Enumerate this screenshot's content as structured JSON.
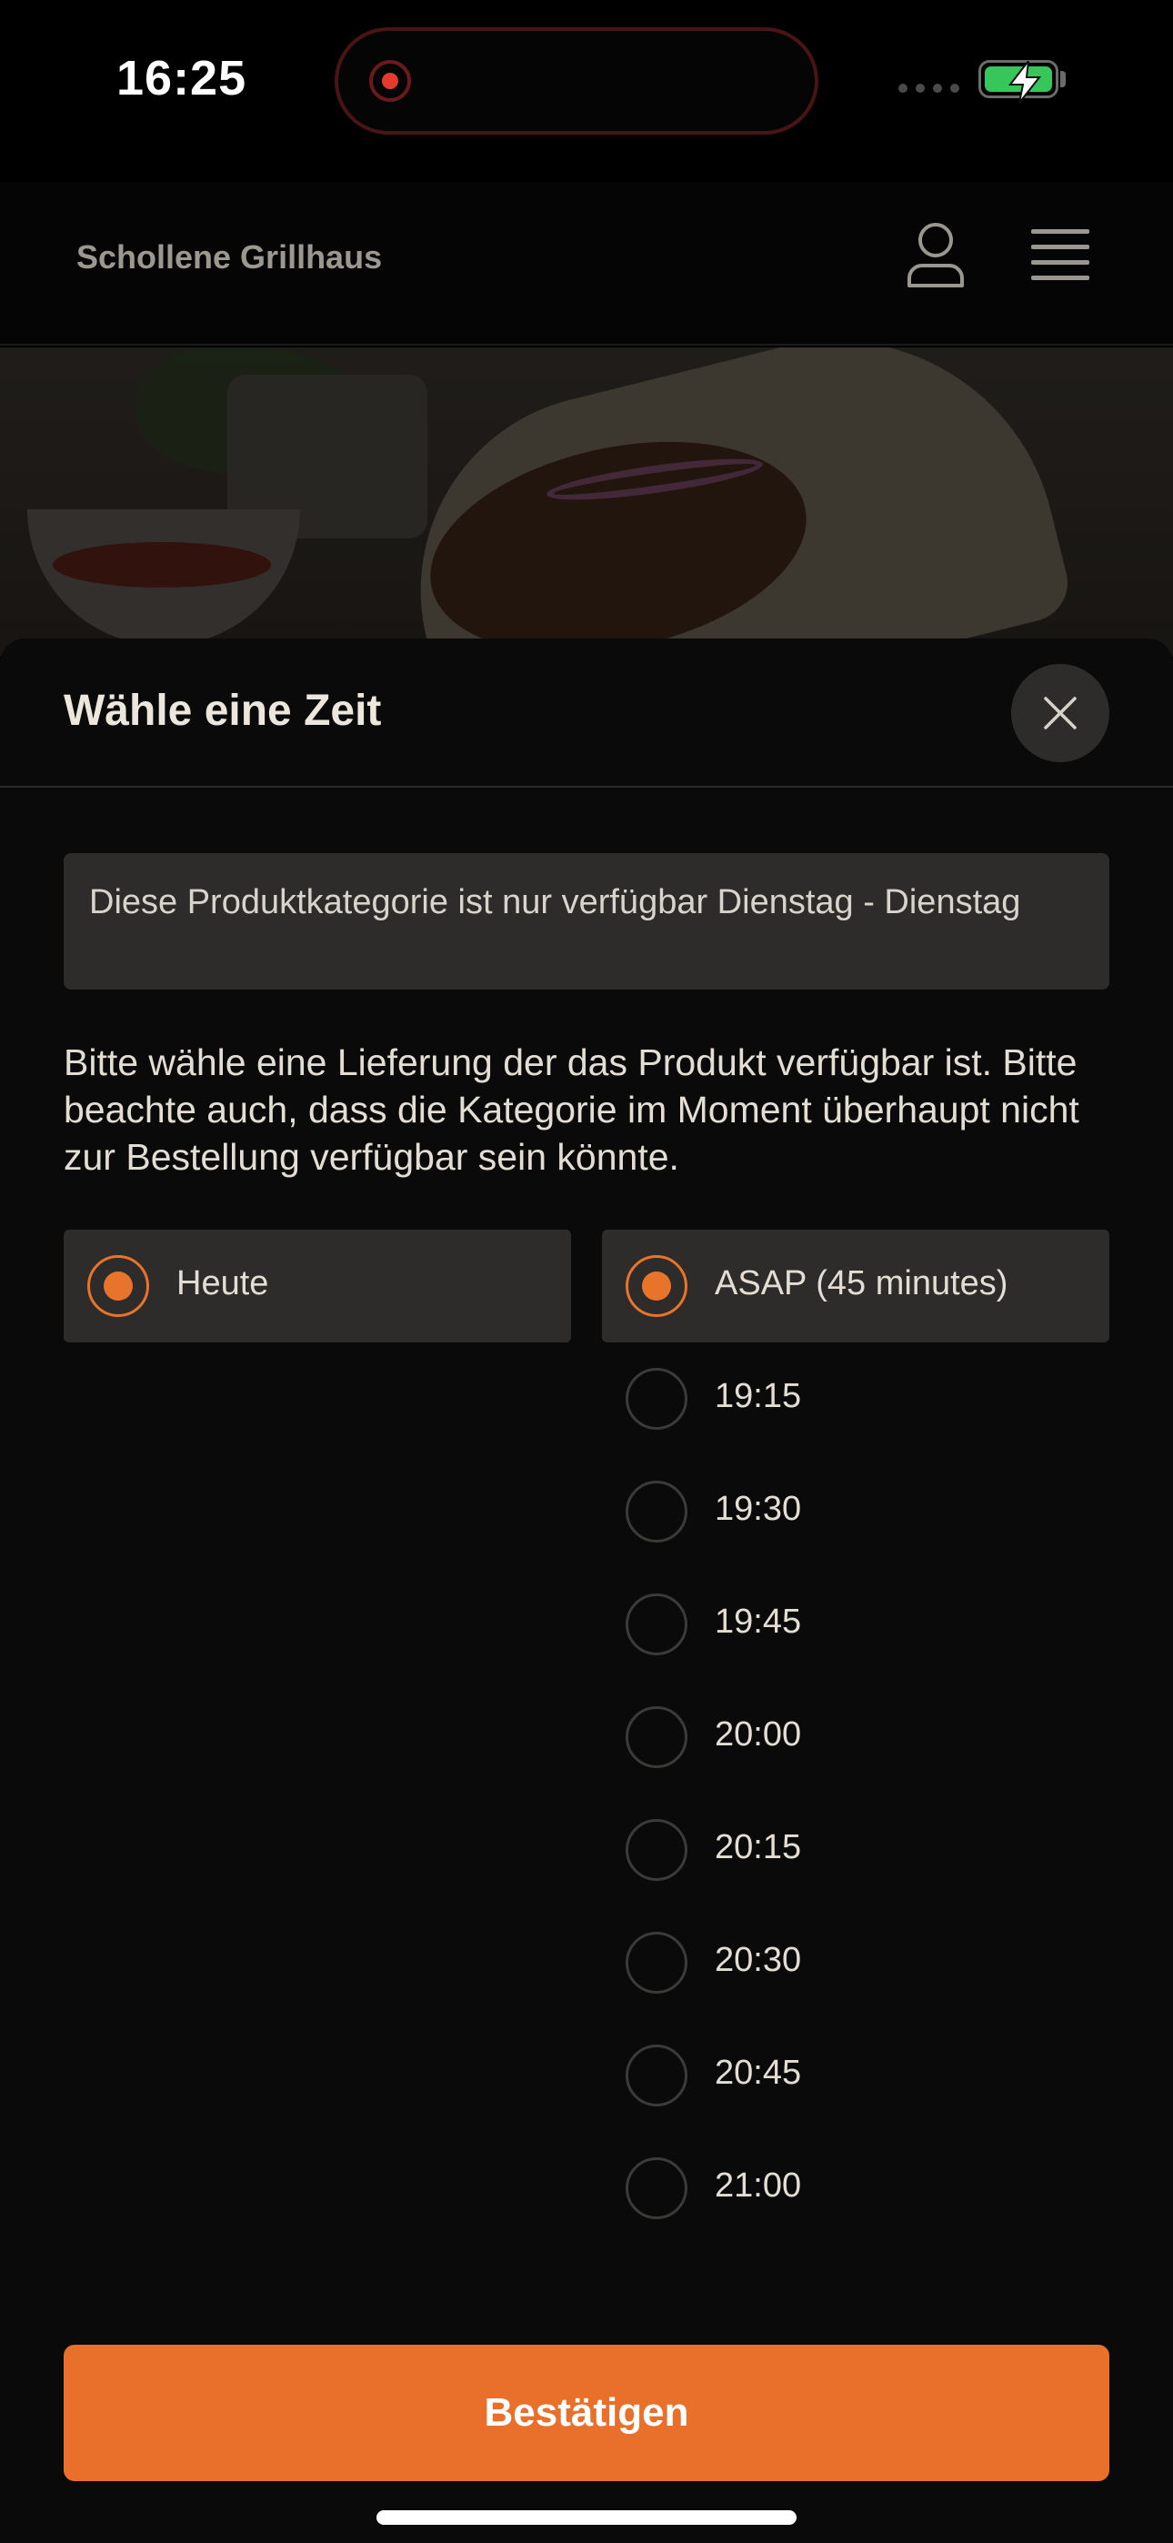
{
  "status_bar": {
    "time": "16:25",
    "battery_level": "charging",
    "battery_color": "#35c759",
    "recording_color": "#e53b2f"
  },
  "header": {
    "brand": "Schollene Grillhaus",
    "icons": [
      "user-icon",
      "menu-icon"
    ]
  },
  "hero": {
    "image": "food-wrap-photo"
  },
  "sheet": {
    "title": "Wähle eine Zeit",
    "close_icon": "close-icon",
    "notice": "Diese Produktkategorie ist nur verfügbar Dienstag - Dienstag",
    "instruction": "Bitte wähle eine Lieferung der das Produkt verfügbar ist. Bitte beachte auch, dass die Kategorie im Moment überhaupt nicht zur Bestellung verfügbar sein könnte.",
    "day": {
      "label": "Heute",
      "selected": true
    },
    "times": [
      {
        "label": "ASAP (45 minutes)",
        "selected": true
      },
      {
        "label": "19:15",
        "selected": false
      },
      {
        "label": "19:30",
        "selected": false
      },
      {
        "label": "19:45",
        "selected": false
      },
      {
        "label": "20:00",
        "selected": false
      },
      {
        "label": "20:15",
        "selected": false
      },
      {
        "label": "20:30",
        "selected": false
      },
      {
        "label": "20:45",
        "selected": false
      },
      {
        "label": "21:00",
        "selected": false
      }
    ],
    "confirm_label": "Bestätigen",
    "accent_color": "#e8702a"
  }
}
